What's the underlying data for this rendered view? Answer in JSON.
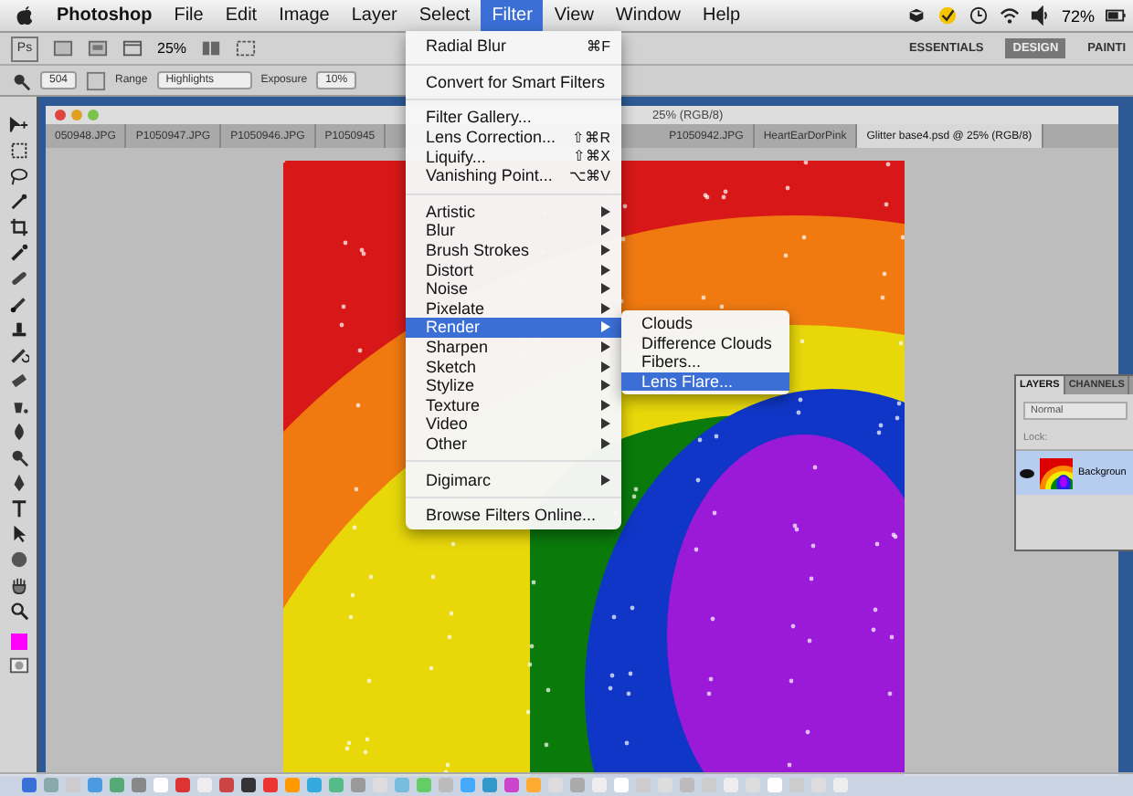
{
  "menu_bar": {
    "app_name": "Photoshop",
    "menus": [
      {
        "label": "File",
        "selected": false
      },
      {
        "label": "Edit",
        "selected": false
      },
      {
        "label": "Image",
        "selected": false
      },
      {
        "label": "Layer",
        "selected": false
      },
      {
        "label": "Select",
        "selected": false
      },
      {
        "label": "Filter",
        "selected": true
      },
      {
        "label": "View",
        "selected": false
      },
      {
        "label": "Window",
        "selected": false
      },
      {
        "label": "Help",
        "selected": false
      }
    ],
    "battery": "72%"
  },
  "app_bar": {
    "logo": "Ps",
    "zoom": "25%",
    "workspaces": [
      {
        "label": "ESSENTIALS",
        "selected": false
      },
      {
        "label": "DESIGN",
        "selected": true
      },
      {
        "label": "PAINTI",
        "selected": false
      }
    ]
  },
  "options_bar": {
    "brush_size": "504",
    "range_label": "Range",
    "range_value": "Highlights",
    "exposure_label": "Exposure",
    "exposure_value": "10%"
  },
  "document": {
    "title": "25% (RGB/8)",
    "tabs": [
      {
        "label": "050948.JPG",
        "selected": false
      },
      {
        "label": "P1050947.JPG",
        "selected": false
      },
      {
        "label": "P1050946.JPG",
        "selected": false
      },
      {
        "label": "P1050945",
        "selected": false
      },
      {
        "label": "P1050942.JPG",
        "selected": false
      },
      {
        "label": "HeartEarDorPink",
        "selected": false
      },
      {
        "label": "Glitter base4.psd @ 25% (RGB/8)",
        "selected": true
      }
    ]
  },
  "filter_menu": {
    "groups": [
      [
        {
          "label": "Radial Blur",
          "shortcut": "⌘F",
          "submenu": false,
          "selected": false
        }
      ],
      [
        {
          "label": "Convert for Smart Filters",
          "submenu": false,
          "selected": false
        }
      ],
      [
        {
          "label": "Filter Gallery...",
          "submenu": false,
          "selected": false
        },
        {
          "label": "Lens Correction...",
          "shortcut": "⇧⌘R",
          "submenu": false,
          "selected": false
        },
        {
          "label": "Liquify...",
          "shortcut": "⇧⌘X",
          "submenu": false,
          "selected": false
        },
        {
          "label": "Vanishing Point...",
          "shortcut": "⌥⌘V",
          "submenu": false,
          "selected": false
        }
      ],
      [
        {
          "label": "Artistic",
          "submenu": true,
          "selected": false
        },
        {
          "label": "Blur",
          "submenu": true,
          "selected": false
        },
        {
          "label": "Brush Strokes",
          "submenu": true,
          "selected": false
        },
        {
          "label": "Distort",
          "submenu": true,
          "selected": false
        },
        {
          "label": "Noise",
          "submenu": true,
          "selected": false
        },
        {
          "label": "Pixelate",
          "submenu": true,
          "selected": false
        },
        {
          "label": "Render",
          "submenu": true,
          "selected": true
        },
        {
          "label": "Sharpen",
          "submenu": true,
          "selected": false
        },
        {
          "label": "Sketch",
          "submenu": true,
          "selected": false
        },
        {
          "label": "Stylize",
          "submenu": true,
          "selected": false
        },
        {
          "label": "Texture",
          "submenu": true,
          "selected": false
        },
        {
          "label": "Video",
          "submenu": true,
          "selected": false
        },
        {
          "label": "Other",
          "submenu": true,
          "selected": false
        }
      ],
      [
        {
          "label": "Digimarc",
          "submenu": true,
          "selected": false
        }
      ],
      [
        {
          "label": "Browse Filters Online...",
          "submenu": false,
          "selected": false
        }
      ]
    ]
  },
  "render_submenu": [
    {
      "label": "Clouds",
      "selected": false
    },
    {
      "label": "Difference Clouds",
      "selected": false
    },
    {
      "label": "Fibers...",
      "selected": false
    },
    {
      "label": "Lens Flare...",
      "selected": true
    }
  ],
  "layers_panel": {
    "tabs": [
      {
        "label": "LAYERS",
        "selected": true
      },
      {
        "label": "CHANNELS",
        "selected": false
      }
    ],
    "blend_mode": "Normal",
    "lock_label": "Lock:",
    "layers": [
      {
        "name": "Backgroun",
        "visible": true
      }
    ]
  }
}
